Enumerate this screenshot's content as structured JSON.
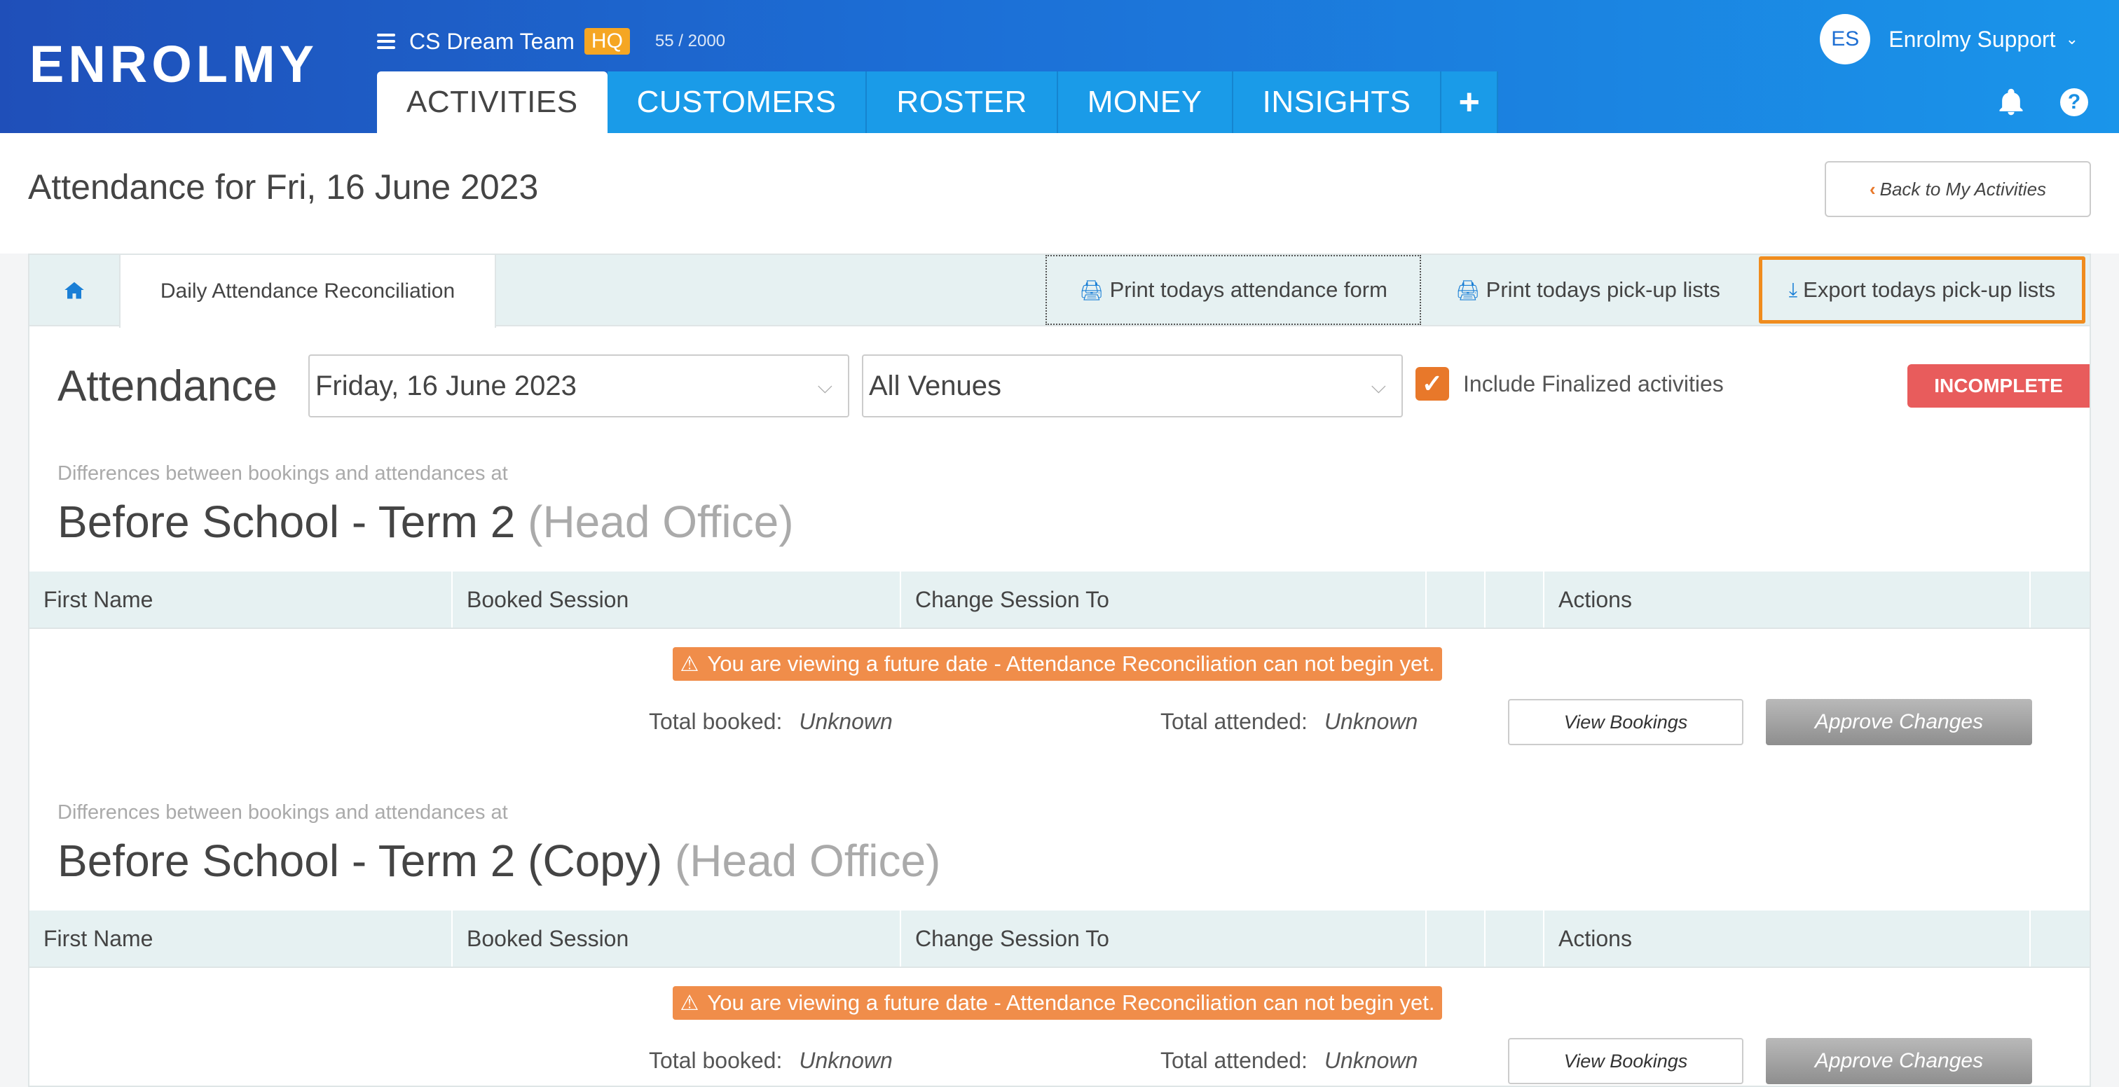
{
  "app": {
    "logo": "ENROLMY"
  },
  "team": {
    "name": "CS Dream Team",
    "badge": "HQ",
    "count": "55 / 2000"
  },
  "user": {
    "initials": "ES",
    "name": "Enrolmy Support"
  },
  "nav": {
    "tabs": [
      "ACTIVITIES",
      "CUSTOMERS",
      "ROSTER",
      "MONEY",
      "INSIGHTS"
    ],
    "active": "ACTIVITIES",
    "plus": "+"
  },
  "page": {
    "title": "Attendance for Fri, 16 June 2023",
    "back_label": "Back to My Activities"
  },
  "tabs": {
    "daily": "Daily Attendance Reconciliation",
    "print_form": "Print todays attendance form",
    "print_pickup": "Print todays pick-up lists",
    "export_pickup": "Export todays pick-up lists"
  },
  "filters": {
    "label": "Attendance",
    "date_value": "Friday, 16 June 2023",
    "venue_value": "All Venues",
    "include_finalized_label": "Include Finalized activities",
    "include_finalized_checked": true,
    "status": "INCOMPLETE"
  },
  "columns": [
    "First Name",
    "Booked Session",
    "Change Session To",
    "",
    "",
    "Actions"
  ],
  "sections": [
    {
      "subtitle": "Differences between bookings and attendances at",
      "title": "Before School - Term 2",
      "venue": "(Head Office)",
      "warning": "You are viewing a future date - Attendance Reconciliation can not begin yet.",
      "total_booked_label": "Total booked:",
      "total_booked": "Unknown",
      "total_attended_label": "Total attended:",
      "total_attended": "Unknown",
      "view_label": "View Bookings",
      "approve_label": "Approve Changes"
    },
    {
      "subtitle": "Differences between bookings and attendances at",
      "title": "Before School - Term 2 (Copy)",
      "venue": "(Head Office)",
      "warning": "You are viewing a future date - Attendance Reconciliation can not begin yet.",
      "total_booked_label": "Total booked:",
      "total_booked": "Unknown",
      "total_attended_label": "Total attended:",
      "total_attended": "Unknown",
      "view_label": "View Bookings",
      "approve_label": "Approve Changes"
    }
  ],
  "colors": {
    "brand_dark": "#1f4fb9",
    "brand_light": "#1a95ea",
    "accent_orange": "#f08c1e",
    "status_red": "#e85c5c",
    "warning_orange": "#f08d4a"
  },
  "icons": [
    "menu-icon",
    "chevron-down-icon",
    "bell-icon",
    "help-icon",
    "home-icon",
    "printer-icon",
    "download-icon",
    "checkmark-icon",
    "warning-icon",
    "chevron-left-icon"
  ]
}
